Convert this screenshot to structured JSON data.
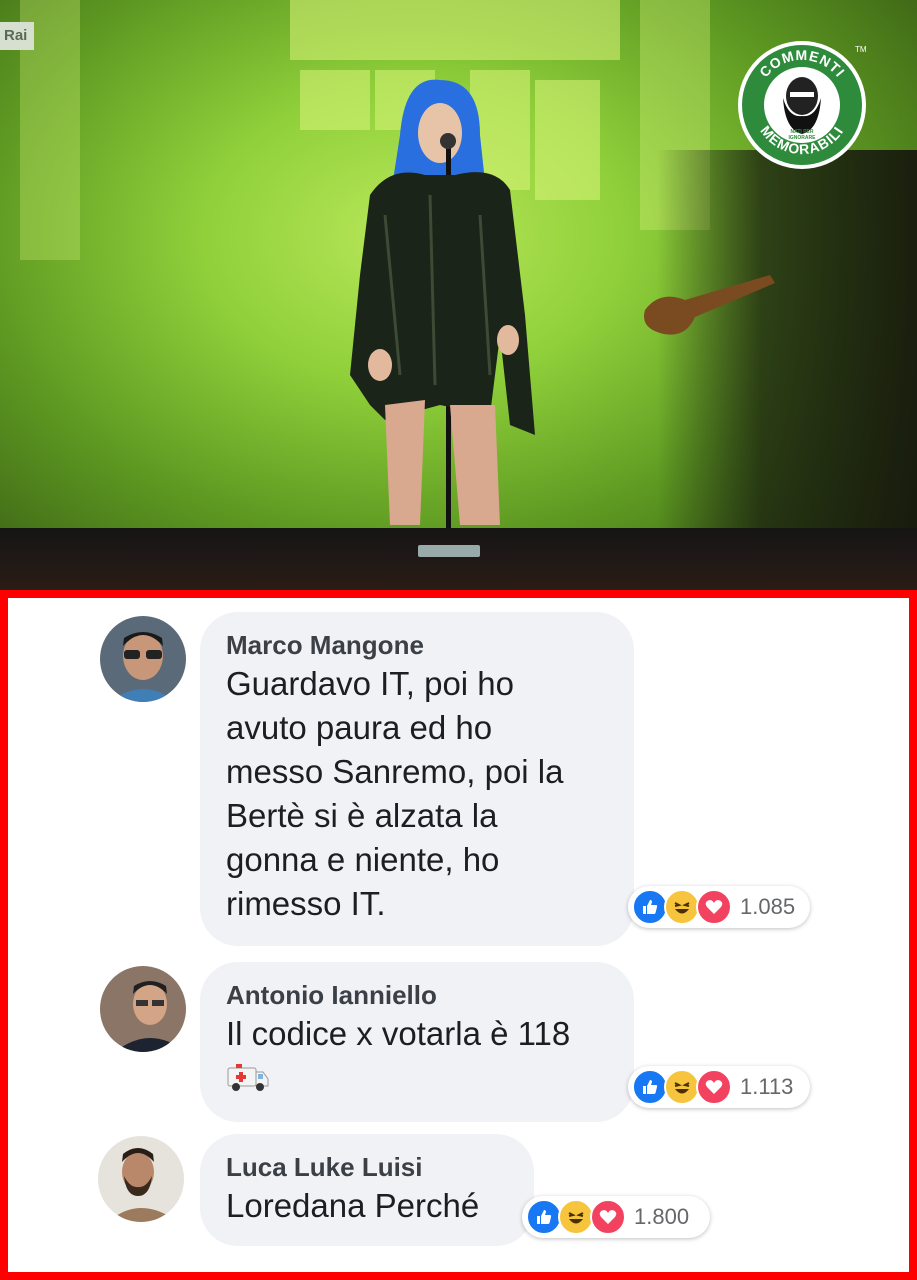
{
  "photo": {
    "channel_mark": "Rai",
    "logo": {
      "top_text": "COMMENTI",
      "bottom_text": "MEMORABILI",
      "middle_text": "NATI PER IGNORARE",
      "trademark": "TM"
    }
  },
  "comments": [
    {
      "author": "Marco Mangone",
      "lines": [
        "Guardavo IT, poi ho",
        "avuto paura ed ho",
        "messo Sanremo, poi la",
        "Bertè si è alzata la",
        "gonna e niente, ho",
        "rimesso IT."
      ],
      "reactions": [
        "like",
        "haha",
        "love"
      ],
      "count": "1.085"
    },
    {
      "author": "Antonio Ianniello",
      "lines": [
        "Il codice x votarla è 118"
      ],
      "emoji": "ambulance-icon",
      "reactions": [
        "like",
        "haha",
        "love"
      ],
      "count": "1.113"
    },
    {
      "author": "Luca Luke Luisi",
      "lines": [
        "Loredana Perché"
      ],
      "reactions": [
        "like",
        "haha",
        "love"
      ],
      "count": "1.800"
    }
  ],
  "colors": {
    "frame_border": "#ff0000",
    "bubble": "#f1f2f6",
    "like": "#1877f2",
    "love": "#f3425f",
    "haha": "#f7c43d",
    "logo_green": "#2e8b3c"
  }
}
